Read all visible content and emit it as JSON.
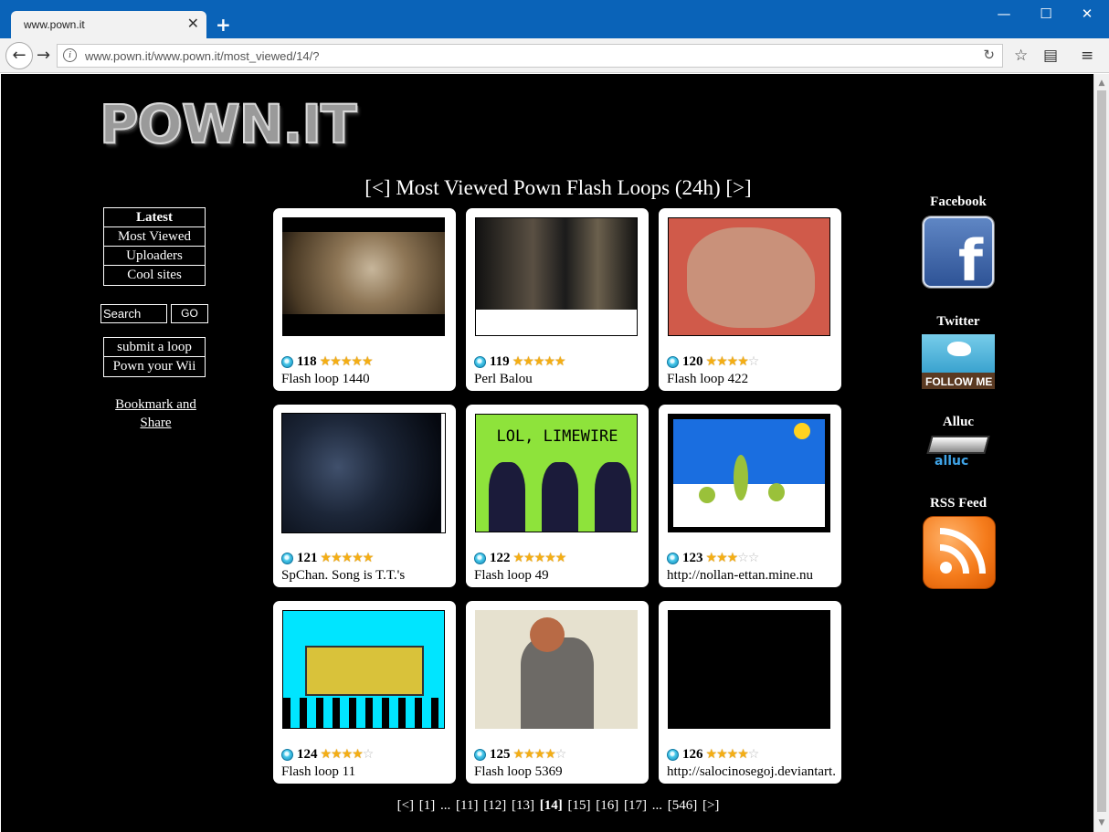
{
  "browser": {
    "tab_title": "www.pown.it",
    "tab_close": "✕",
    "new_tab": "+",
    "url": "www.pown.it/www.pown.it/most_viewed/14/?",
    "controls": {
      "minimize": "—",
      "maximize": "☐",
      "close": "✕"
    }
  },
  "site": {
    "logo": "POWN.IT",
    "heading": "[<] Most Viewed Pown Flash Loops (24h) [>]"
  },
  "nav": {
    "items": [
      {
        "label": "Latest",
        "active": true
      },
      {
        "label": "Most Viewed",
        "active": false
      },
      {
        "label": "Uploaders",
        "active": false
      },
      {
        "label": "Cool sites",
        "active": false
      }
    ],
    "search_placeholder": "Search",
    "go_label": "GO",
    "extra": [
      {
        "label": "submit a loop"
      },
      {
        "label": "Pown your Wii"
      }
    ],
    "bookmark": "Bookmark and Share"
  },
  "loops": [
    {
      "id": "118",
      "stars": 5,
      "caption": "Flash loop 1440",
      "thumb": "gandalf"
    },
    {
      "id": "119",
      "stars": 5,
      "caption": "Perl Balou",
      "thumb": "dark-scene"
    },
    {
      "id": "120",
      "stars": 4,
      "caption": "Flash loop 422",
      "thumb": "hand"
    },
    {
      "id": "121",
      "stars": 5,
      "caption": "SpChan. Song is T.T.'s",
      "thumb": "dark-blue"
    },
    {
      "id": "122",
      "stars": 5,
      "caption": "Flash loop 49",
      "thumb": "limewire",
      "thumb_text": "LOL, LIMEWIRE"
    },
    {
      "id": "123",
      "stars": 3,
      "caption": "http://nollan-ettan.mine.nu",
      "thumb": "snow"
    },
    {
      "id": "124",
      "stars": 4,
      "caption": "Flash loop 11",
      "thumb": "tank"
    },
    {
      "id": "125",
      "stars": 4,
      "caption": "Flash loop 5369",
      "thumb": "office"
    },
    {
      "id": "126",
      "stars": 4,
      "caption": "http://salocinosegoj.deviantart.",
      "thumb": "black"
    }
  ],
  "pager": [
    "[<]",
    "[1]",
    "...",
    "[11]",
    "[12]",
    "[13]",
    "[14]",
    "[15]",
    "[16]",
    "[17]",
    "...",
    "[546]",
    "[>]"
  ],
  "pager_current": "[14]",
  "social": {
    "facebook": "Facebook",
    "twitter": "Twitter",
    "twitter_badge": "FOLLOW ME",
    "alluc": "Alluc",
    "alluc_logo": "alluc",
    "rss": "RSS Feed"
  }
}
